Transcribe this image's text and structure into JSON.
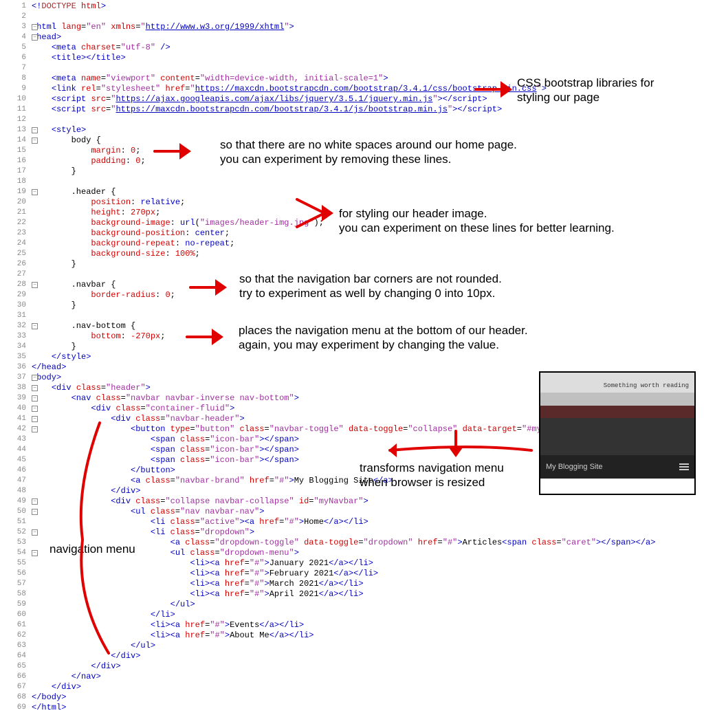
{
  "lines": [
    {
      "n": 1,
      "html": "<span class='t-tag'>&lt;!</span><span class='t-doctype'>DOCTYPE</span> <span class='t-attr'>html</span><span class='t-tag'>&gt;</span>"
    },
    {
      "n": 2,
      "html": ""
    },
    {
      "n": 3,
      "html": "<span class='t-tag'>&lt;html</span> <span class='t-attr'>lang</span>=<span class='t-str'>\"en\"</span> <span class='t-attr'>xmlns</span>=<span class='t-str'>\"</span><span class='t-url'>http://www.w3.org/1999/xhtml</span><span class='t-str'>\"</span><span class='t-tag'>&gt;</span>",
      "fold": true
    },
    {
      "n": 4,
      "html": "<span class='t-tag'>&lt;head&gt;</span>",
      "fold": true
    },
    {
      "n": 5,
      "html": "    <span class='t-tag'>&lt;meta</span> <span class='t-attr'>charset</span>=<span class='t-str'>\"utf-8\"</span> <span class='t-tag'>/&gt;</span>"
    },
    {
      "n": 6,
      "html": "    <span class='t-tag'>&lt;title&gt;&lt;/title&gt;</span>"
    },
    {
      "n": 7,
      "html": ""
    },
    {
      "n": 8,
      "html": "    <span class='t-tag'>&lt;meta</span> <span class='t-attr'>name</span>=<span class='t-str'>\"viewport\"</span> <span class='t-attr'>content</span>=<span class='t-str'>\"width=device-width, initial-scale=1\"</span><span class='t-tag'>&gt;</span>"
    },
    {
      "n": 9,
      "html": "    <span class='t-tag'>&lt;link</span> <span class='t-attr'>rel</span>=<span class='t-str'>\"stylesheet\"</span> <span class='t-attr'>href</span>=<span class='t-str'>\"</span><span class='t-url'>https://maxcdn.bootstrapcdn.com/bootstrap/3.4.1/css/bootstrap.min.css</span><span class='t-str'>\"</span><span class='t-tag'>&gt;</span>"
    },
    {
      "n": 10,
      "html": "    <span class='t-tag'>&lt;script</span> <span class='t-attr'>src</span>=<span class='t-str'>\"</span><span class='t-url'>https://ajax.googleapis.com/ajax/libs/jquery/3.5.1/jquery.min.js</span><span class='t-str'>\"</span><span class='t-tag'>&gt;&lt;/script&gt;</span>"
    },
    {
      "n": 11,
      "html": "    <span class='t-tag'>&lt;script</span> <span class='t-attr'>src</span>=<span class='t-str'>\"</span><span class='t-url'>https://maxcdn.bootstrapcdn.com/bootstrap/3.4.1/js/bootstrap.min.js</span><span class='t-str'>\"</span><span class='t-tag'>&gt;&lt;/script&gt;</span>"
    },
    {
      "n": 12,
      "html": ""
    },
    {
      "n": 13,
      "html": "    <span class='t-tag'>&lt;style&gt;</span>",
      "fold": true
    },
    {
      "n": 14,
      "html": "        <span class='t-txt'>body {</span>",
      "fold": true
    },
    {
      "n": 15,
      "html": "            <span class='t-attr'>margin</span>: <span class='t-num'>0</span>;"
    },
    {
      "n": 16,
      "html": "            <span class='t-attr'>padding</span>: <span class='t-num'>0</span>;"
    },
    {
      "n": 17,
      "html": "        }"
    },
    {
      "n": 18,
      "html": ""
    },
    {
      "n": 19,
      "html": "        <span class='t-txt'>.header {</span>",
      "fold": true
    },
    {
      "n": 20,
      "html": "            <span class='t-attr'>position</span>: <span class='t-css-val'>relative</span>;"
    },
    {
      "n": 21,
      "html": "            <span class='t-attr'>height</span>: <span class='t-num'>270px</span>;"
    },
    {
      "n": 22,
      "html": "            <span class='t-attr'>background-image</span>: <span class='t-css-val'>url</span>(<span class='t-str'>\"images/header-img.jpg\"</span>);"
    },
    {
      "n": 23,
      "html": "            <span class='t-attr'>background-position</span>: <span class='t-css-val'>center</span>;"
    },
    {
      "n": 24,
      "html": "            <span class='t-attr'>background-repeat</span>: <span class='t-css-val'>no-repeat</span>;"
    },
    {
      "n": 25,
      "html": "            <span class='t-attr'>background-size</span>: <span class='t-num'>100%</span>;"
    },
    {
      "n": 26,
      "html": "        }"
    },
    {
      "n": 27,
      "html": ""
    },
    {
      "n": 28,
      "html": "        <span class='t-txt'>.navbar {</span>",
      "fold": true
    },
    {
      "n": 29,
      "html": "            <span class='t-attr'>border-radius</span>: <span class='t-num'>0</span>;"
    },
    {
      "n": 30,
      "html": "        }"
    },
    {
      "n": 31,
      "html": ""
    },
    {
      "n": 32,
      "html": "        <span class='t-txt'>.nav-bottom {</span>",
      "fold": true
    },
    {
      "n": 33,
      "html": "            <span class='t-attr'>bottom</span>: <span class='t-num'>-270px</span>;"
    },
    {
      "n": 34,
      "html": "        }"
    },
    {
      "n": 35,
      "html": "    <span class='t-tag'>&lt;/style&gt;</span>"
    },
    {
      "n": 36,
      "html": "<span class='t-tag'>&lt;/head&gt;</span>"
    },
    {
      "n": 37,
      "html": "<span class='t-tag'>&lt;body&gt;</span>",
      "fold": true
    },
    {
      "n": 38,
      "html": "    <span class='t-tag'>&lt;div</span> <span class='t-attr'>class</span>=<span class='t-str'>\"header\"</span><span class='t-tag'>&gt;</span>",
      "fold": true
    },
    {
      "n": 39,
      "html": "        <span class='t-tag'>&lt;nav</span> <span class='t-attr'>class</span>=<span class='t-str'>\"navbar navbar-inverse nav-bottom\"</span><span class='t-tag'>&gt;</span>",
      "fold": true
    },
    {
      "n": 40,
      "html": "            <span class='t-tag'>&lt;div</span> <span class='t-attr'>class</span>=<span class='t-str'>\"container-fluid\"</span><span class='t-tag'>&gt;</span>",
      "fold": true
    },
    {
      "n": 41,
      "html": "                <span class='t-tag'>&lt;div</span> <span class='t-attr'>class</span>=<span class='t-str'>\"navbar-header\"</span><span class='t-tag'>&gt;</span>",
      "fold": true
    },
    {
      "n": 42,
      "html": "                    <span class='t-tag'>&lt;button</span> <span class='t-attr'>type</span>=<span class='t-str'>\"button\"</span> <span class='t-attr'>class</span>=<span class='t-str'>\"navbar-toggle\"</span> <span class='t-attr'>data-toggle</span>=<span class='t-str'>\"collapse\"</span> <span class='t-attr'>data-target</span>=<span class='t-str'>\"#myNavbar\"</span><span class='t-tag'>&gt;</span>",
      "fold": true
    },
    {
      "n": 43,
      "html": "                        <span class='t-tag'>&lt;span</span> <span class='t-attr'>class</span>=<span class='t-str'>\"icon-bar\"</span><span class='t-tag'>&gt;&lt;/span&gt;</span>"
    },
    {
      "n": 44,
      "html": "                        <span class='t-tag'>&lt;span</span> <span class='t-attr'>class</span>=<span class='t-str'>\"icon-bar\"</span><span class='t-tag'>&gt;&lt;/span&gt;</span>"
    },
    {
      "n": 45,
      "html": "                        <span class='t-tag'>&lt;span</span> <span class='t-attr'>class</span>=<span class='t-str'>\"icon-bar\"</span><span class='t-tag'>&gt;&lt;/span&gt;</span>"
    },
    {
      "n": 46,
      "html": "                    <span class='t-tag'>&lt;/button&gt;</span>"
    },
    {
      "n": 47,
      "html": "                    <span class='t-tag'>&lt;a</span> <span class='t-attr'>class</span>=<span class='t-str'>\"navbar-brand\"</span> <span class='t-attr'>href</span>=<span class='t-str'>\"#\"</span><span class='t-tag'>&gt;</span><span class='t-txt'>My Blogging Site</span><span class='t-tag'>&lt;/a&gt;</span>"
    },
    {
      "n": 48,
      "html": "                <span class='t-tag'>&lt;/div&gt;</span>"
    },
    {
      "n": 49,
      "html": "                <span class='t-tag'>&lt;div</span> <span class='t-attr'>class</span>=<span class='t-str'>\"collapse navbar-collapse\"</span> <span class='t-attr'>id</span>=<span class='t-str'>\"myNavbar\"</span><span class='t-tag'>&gt;</span>",
      "fold": true
    },
    {
      "n": 50,
      "html": "                    <span class='t-tag'>&lt;ul</span> <span class='t-attr'>class</span>=<span class='t-str'>\"nav navbar-nav\"</span><span class='t-tag'>&gt;</span>",
      "fold": true
    },
    {
      "n": 51,
      "html": "                        <span class='t-tag'>&lt;li</span> <span class='t-attr'>class</span>=<span class='t-str'>\"active\"</span><span class='t-tag'>&gt;&lt;a</span> <span class='t-attr'>href</span>=<span class='t-str'>\"#\"</span><span class='t-tag'>&gt;</span><span class='t-txt'>Home</span><span class='t-tag'>&lt;/a&gt;&lt;/li&gt;</span>"
    },
    {
      "n": 52,
      "html": "                        <span class='t-tag'>&lt;li</span> <span class='t-attr'>class</span>=<span class='t-str'>\"dropdown\"</span><span class='t-tag'>&gt;</span>",
      "fold": true
    },
    {
      "n": 53,
      "html": "                            <span class='t-tag'>&lt;a</span> <span class='t-attr'>class</span>=<span class='t-str'>\"dropdown-toggle\"</span> <span class='t-attr'>data-toggle</span>=<span class='t-str'>\"dropdown\"</span> <span class='t-attr'>href</span>=<span class='t-str'>\"#\"</span><span class='t-tag'>&gt;</span><span class='t-txt'>Articles</span><span class='t-tag'>&lt;span</span> <span class='t-attr'>class</span>=<span class='t-str'>\"caret\"</span><span class='t-tag'>&gt;&lt;/span&gt;&lt;/a&gt;</span>"
    },
    {
      "n": 54,
      "html": "                            <span class='t-tag'>&lt;ul</span> <span class='t-attr'>class</span>=<span class='t-str'>\"dropdown-menu\"</span><span class='t-tag'>&gt;</span>",
      "fold": true
    },
    {
      "n": 55,
      "html": "                                <span class='t-tag'>&lt;li&gt;&lt;a</span> <span class='t-attr'>href</span>=<span class='t-str'>\"#\"</span><span class='t-tag'>&gt;</span><span class='t-txt'>January 2021</span><span class='t-tag'>&lt;/a&gt;&lt;/li&gt;</span>"
    },
    {
      "n": 56,
      "html": "                                <span class='t-tag'>&lt;li&gt;&lt;a</span> <span class='t-attr'>href</span>=<span class='t-str'>\"#\"</span><span class='t-tag'>&gt;</span><span class='t-txt'>February 2021</span><span class='t-tag'>&lt;/a&gt;&lt;/li&gt;</span>"
    },
    {
      "n": 57,
      "html": "                                <span class='t-tag'>&lt;li&gt;&lt;a</span> <span class='t-attr'>href</span>=<span class='t-str'>\"#\"</span><span class='t-tag'>&gt;</span><span class='t-txt'>March 2021</span><span class='t-tag'>&lt;/a&gt;&lt;/li&gt;</span>"
    },
    {
      "n": 58,
      "html": "                                <span class='t-tag'>&lt;li&gt;&lt;a</span> <span class='t-attr'>href</span>=<span class='t-str'>\"#\"</span><span class='t-tag'>&gt;</span><span class='t-txt'>April 2021</span><span class='t-tag'>&lt;/a&gt;&lt;/li&gt;</span>"
    },
    {
      "n": 59,
      "html": "                            <span class='t-tag'>&lt;/ul&gt;</span>"
    },
    {
      "n": 60,
      "html": "                        <span class='t-tag'>&lt;/li&gt;</span>"
    },
    {
      "n": 61,
      "html": "                        <span class='t-tag'>&lt;li&gt;&lt;a</span> <span class='t-attr'>href</span>=<span class='t-str'>\"#\"</span><span class='t-tag'>&gt;</span><span class='t-txt'>Events</span><span class='t-tag'>&lt;/a&gt;&lt;/li&gt;</span>"
    },
    {
      "n": 62,
      "html": "                        <span class='t-tag'>&lt;li&gt;&lt;a</span> <span class='t-attr'>href</span>=<span class='t-str'>\"#\"</span><span class='t-tag'>&gt;</span><span class='t-txt'>About Me</span><span class='t-tag'>&lt;/a&gt;&lt;/li&gt;</span>"
    },
    {
      "n": 63,
      "html": "                    <span class='t-tag'>&lt;/ul&gt;</span>"
    },
    {
      "n": 64,
      "html": "                <span class='t-tag'>&lt;/div&gt;</span>"
    },
    {
      "n": 65,
      "html": "            <span class='t-tag'>&lt;/div&gt;</span>"
    },
    {
      "n": 66,
      "html": "        <span class='t-tag'>&lt;/nav&gt;</span>"
    },
    {
      "n": 67,
      "html": "    <span class='t-tag'>&lt;/div&gt;</span>"
    },
    {
      "n": 68,
      "html": "<span class='t-tag'>&lt;/body&gt;</span>"
    },
    {
      "n": 69,
      "html": "<span class='t-tag'>&lt;/html&gt;</span>"
    }
  ],
  "annotations": {
    "a1": "CSS bootstrap libraries for\nstyling our page",
    "a2": "so that there are no white spaces around our home page.\nyou can experiment by removing these lines.",
    "a3": "for styling our header image.\nyou can experiment on these lines for better learning.",
    "a4": "so that the navigation bar corners are not rounded.\ntry to experiment as well by changing 0 into 10px.",
    "a5": "places the navigation menu at the bottom of our header.\nagain, you may experiment by changing the value.",
    "a6": "transforms navigation menu\nwhen browser is resized",
    "a7": "navigation menu"
  },
  "preview": {
    "caption": "Something worth reading",
    "brand": "My Blogging Site"
  }
}
